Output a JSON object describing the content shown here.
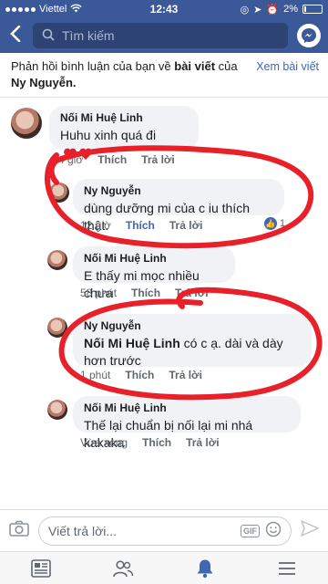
{
  "status": {
    "carrier": "Viettel",
    "time": "12:43",
    "battery": "2%"
  },
  "nav": {
    "search_placeholder": "Tìm kiếm"
  },
  "notice": {
    "text_prefix": "Phản hồi bình luận của bạn về ",
    "bold_post": "bài viết",
    "text_mid": " của",
    "author": "Ny Nguyễn.",
    "link": "Xem bài viết"
  },
  "comments": [
    {
      "name": "Nối Mi Huệ Linh",
      "text": "Huhu xinh quá đi",
      "time": "4 giờ",
      "like": "Thích",
      "reply": "Trả lời",
      "reaction": "❤️❤️"
    },
    {
      "name": "Ny Nguyễn",
      "text": "dùng dưỡng mi của c iu thích thật.",
      "time": "12 giờ",
      "like": "Thích",
      "reply": "Trả lời",
      "likes": "1"
    },
    {
      "name": "Nối Mi Huệ Linh",
      "text": "E thấy mi mọc nhiều chưa",
      "time": "58 phút",
      "like": "Thích",
      "reply": "Trả lời"
    },
    {
      "name": "Ny Nguyễn",
      "mention": "Nối Mi Huệ Linh",
      "text": " có c ạ. dài và dày hơn trước",
      "time": "1 phút",
      "like": "Thích",
      "reply": "Trả lời"
    },
    {
      "name": "Nối Mi Huệ Linh",
      "text": "Thế lại chuẩn bị nối lại mi nhá kakaka",
      "time": "Vừa xong",
      "like": "Thích",
      "reply": "Trả lời"
    }
  ],
  "reply_bar": {
    "placeholder": "Viết trả lời...",
    "gif": "GIF"
  },
  "tabs": [
    "news-feed",
    "friends",
    "notifications",
    "menu"
  ],
  "colors": {
    "brand": "#3b5998",
    "link": "#4267b2",
    "annotation": "#e8202a"
  }
}
